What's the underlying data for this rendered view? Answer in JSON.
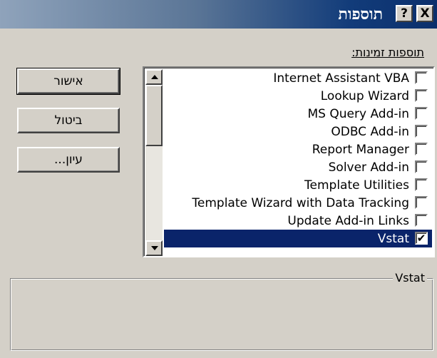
{
  "window": {
    "title": "תוספות",
    "help_button": "?",
    "close_button": "X"
  },
  "list": {
    "label": "תוספות זמינות:",
    "items": [
      {
        "label": "Internet Assistant VBA",
        "checked": false,
        "selected": false,
        "mark": ""
      },
      {
        "label": "Lookup Wizard",
        "checked": false,
        "selected": false,
        "mark": ""
      },
      {
        "label": "MS Query Add-in",
        "checked": false,
        "selected": false,
        "mark": ""
      },
      {
        "label": "ODBC Add-in",
        "checked": false,
        "selected": false,
        "mark": ""
      },
      {
        "label": "Report Manager",
        "checked": false,
        "selected": false,
        "mark": ""
      },
      {
        "label": "Solver Add-in",
        "checked": false,
        "selected": false,
        "mark": ""
      },
      {
        "label": "Template Utilities",
        "checked": false,
        "selected": false,
        "mark": ""
      },
      {
        "label": "Template Wizard with Data Tracking",
        "checked": false,
        "selected": false,
        "mark": ""
      },
      {
        "label": "Update Add-in Links",
        "checked": false,
        "selected": false,
        "mark": ""
      },
      {
        "label": "Vstat",
        "checked": true,
        "selected": true,
        "mark": "✔"
      }
    ]
  },
  "buttons": {
    "ok": "אישור",
    "cancel": "ביטול",
    "browse": "עיון..."
  },
  "description": {
    "title": "Vstat"
  },
  "colors": {
    "selection": "#0a246a",
    "face": "#d4d0c8"
  }
}
